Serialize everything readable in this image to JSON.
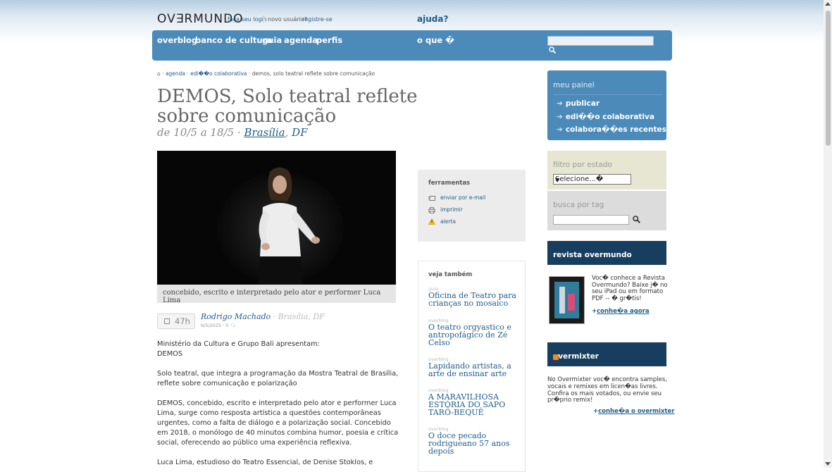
{
  "header": {
    "logo": "OV∃RMUNDO",
    "login": "faça seu login",
    "novo_usuario": "novo usuário?",
    "registre": "registre-se",
    "ajuda": "ajuda?"
  },
  "nav": {
    "items": [
      "overblog",
      "banco de cultura",
      "guia",
      "agenda",
      "perfis"
    ],
    "o_que": "o que �"
  },
  "breadcrumb": {
    "home_icon": "⌂",
    "sep": "·",
    "links": [
      "agenda",
      "edi��o colaborativa"
    ],
    "current": "demos, solo teatral reflete sobre comunicação"
  },
  "article": {
    "title": "DEMOS, Solo teatral reflete sobre comunicação",
    "dates": "de 10/5 a 18/5",
    "date_sep": "·",
    "city": "Brasília",
    "state": "DF",
    "photo_caption": "concebido, escrito e interpretado pelo ator e performer Luca Lima",
    "time_badge": "47h",
    "author": "Rodrigo Machado",
    "author_loc": "· Brasília, DF",
    "posted": "6/5/2025 · 0",
    "paragraphs": [
      "Ministério da Cultura e Grupo Bali apresentam:",
      "DEMOS",
      "Solo teatral, que integra a programação da Mostra Teatral de Brasília, reflete sobre comunicação e polarização",
      "DEMOS, concebido, escrito e interpretado pelo ator e performer Luca Lima, surge como resposta artística a questões contemporâneas urgentes, como a falta de diálogo e a polarização social. Concebido em 2018, o monólogo de 40 minutos combina humor, poesia e crítica social, oferecendo ao público uma experiência reflexiva.",
      "Luca Lima, estudioso do Teatro Essencial, de Denise Stoklos, e"
    ]
  },
  "tools": {
    "title": "ferramentas",
    "items": [
      "enviar por e-mail",
      "imprimir",
      "alerta"
    ]
  },
  "veja": {
    "title": "veja também",
    "items": [
      {
        "cat": "guia",
        "title": "Oficina de Teatro para crianças no mosaico"
      },
      {
        "cat": "overblog",
        "title": "O teatro orgyastico e antropofágico de Zé Celso"
      },
      {
        "cat": "overblog",
        "title": "Lapidando artistas, a arte de ensinar arte"
      },
      {
        "cat": "overblog",
        "title": "A MARAVILHOSA ESTÓRIA DO SAPO TARÔ-BEQUÊ"
      },
      {
        "cat": "overblog",
        "title": "O doce pecado rodrigueano 57 anos depois"
      }
    ]
  },
  "panel": {
    "title": "meu painel",
    "items": [
      "publicar",
      "edi��o colaborativa",
      "colabora��es recentes"
    ],
    "arrow": "➔"
  },
  "filtro": {
    "title": "filtro por estado",
    "selected": "Selecione...�"
  },
  "tag": {
    "title": "busca por tag"
  },
  "revista": {
    "title": "revista overmundo",
    "text": "Voc� conhece a Revista Overmundo? Baixe j� no seu iPad ou em formato PDF -- � gr�tis!",
    "link_prefix": "+",
    "link": "conhe�a agora"
  },
  "overmixter": {
    "title": "overmixter",
    "text": "No Overmixter voc� encontra samples, vocais e remixes em licen�as livres. Confira os mais votados, ou envie seu pr�prio remix!",
    "link_prefix": "+",
    "link": "conhe�a o overmixter"
  },
  "colors": {
    "nav_blue": "#4c8ab9",
    "dark_blue": "#173e5f",
    "link_blue": "#1f5c8a",
    "filter_bg": "#e7e6d3"
  }
}
